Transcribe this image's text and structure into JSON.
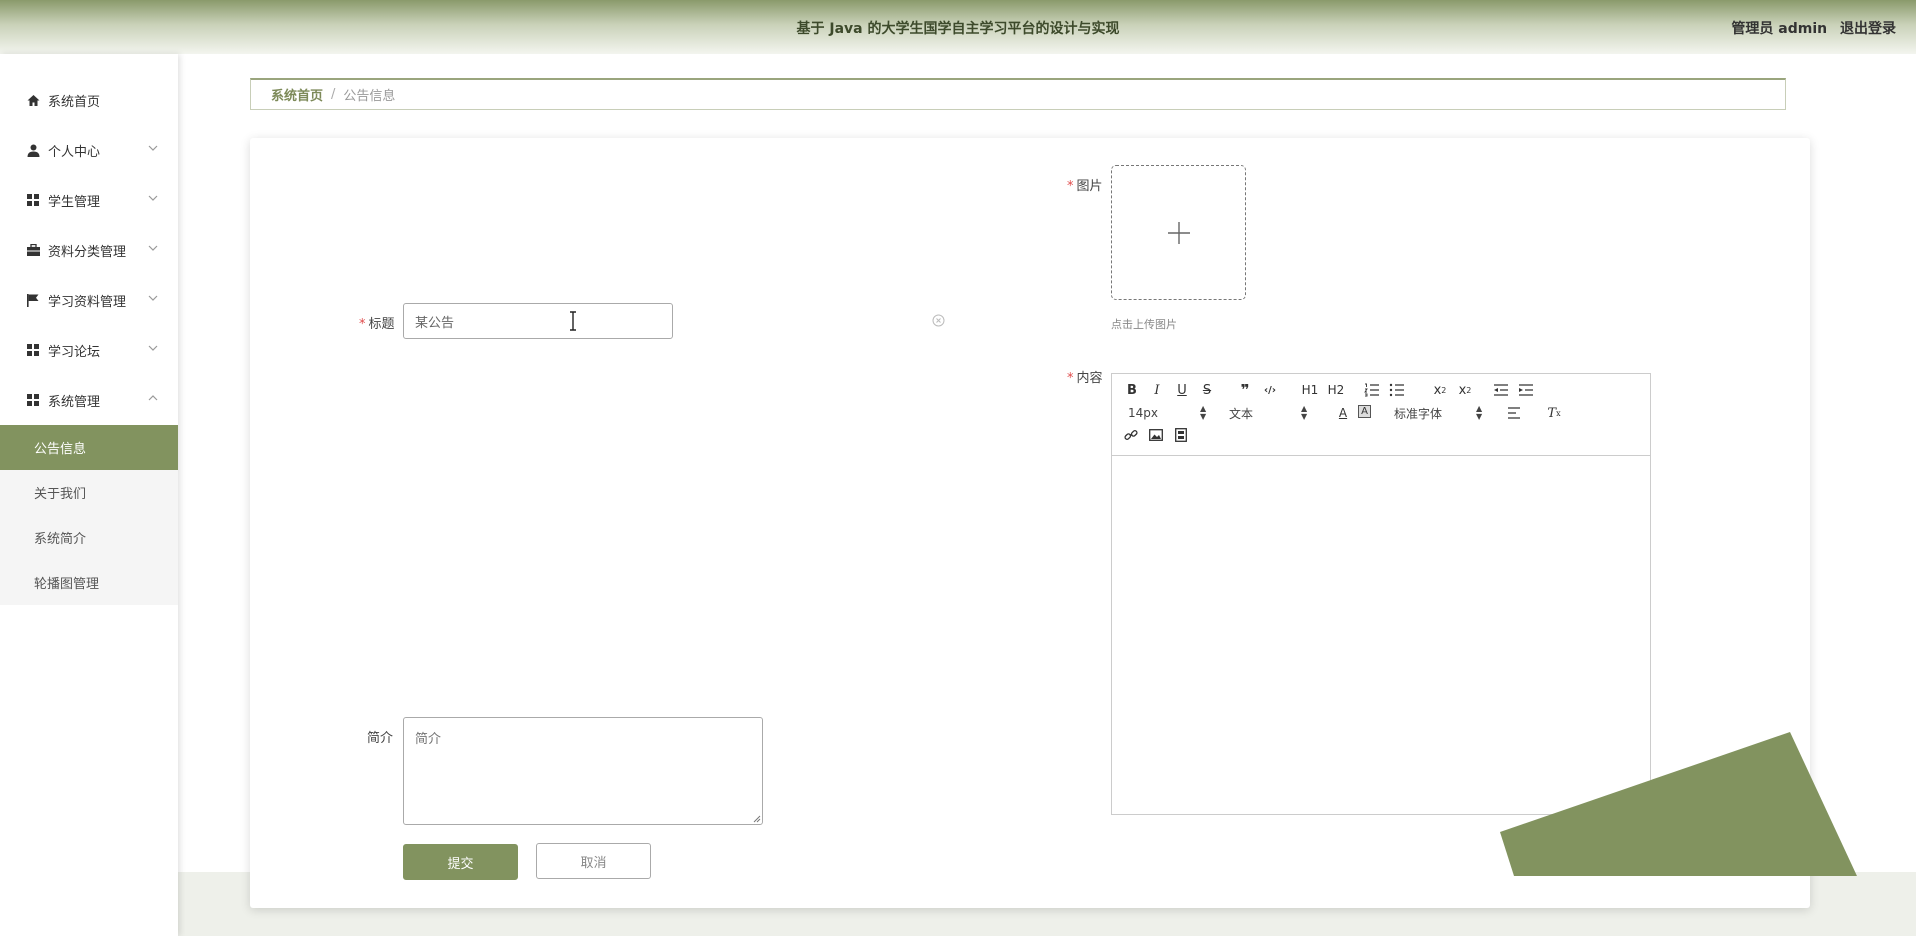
{
  "header": {
    "title": "基于 Java 的大学生国学自主学习平台的设计与实现",
    "user_label": "管理员 admin",
    "logout_label": "退出登录"
  },
  "sidebar": {
    "items": [
      {
        "label": "系统首页",
        "icon": "home-icon"
      },
      {
        "label": "个人中心",
        "icon": "user-icon"
      },
      {
        "label": "学生管理",
        "icon": "grid-icon"
      },
      {
        "label": "资料分类管理",
        "icon": "briefcase-icon"
      },
      {
        "label": "学习资料管理",
        "icon": "flag-icon"
      },
      {
        "label": "学习论坛",
        "icon": "grid-icon"
      },
      {
        "label": "系统管理",
        "icon": "grid-icon"
      }
    ],
    "submenu": [
      {
        "label": "公告信息",
        "active": true
      },
      {
        "label": "关于我们",
        "active": false
      },
      {
        "label": "系统简介",
        "active": false
      },
      {
        "label": "轮播图管理",
        "active": false
      }
    ]
  },
  "breadcrumb": {
    "home": "系统首页",
    "separator": "/",
    "current": "公告信息"
  },
  "form": {
    "required_mark": "*",
    "title_label": "标题",
    "title_value": "某公告",
    "intro_label": "简介",
    "intro_placeholder": "简介",
    "image_label": "图片",
    "upload_hint": "点击上传图片",
    "content_label": "内容",
    "submit_label": "提交",
    "cancel_label": "取消"
  },
  "editor": {
    "font_size": "14px",
    "header_select": "文本",
    "font_family": "标准字体",
    "h1": "H1",
    "h2": "H2"
  },
  "colors": {
    "accent": "#82935f",
    "header_dark": "#3d4a2b",
    "required": "#e04a4a"
  }
}
